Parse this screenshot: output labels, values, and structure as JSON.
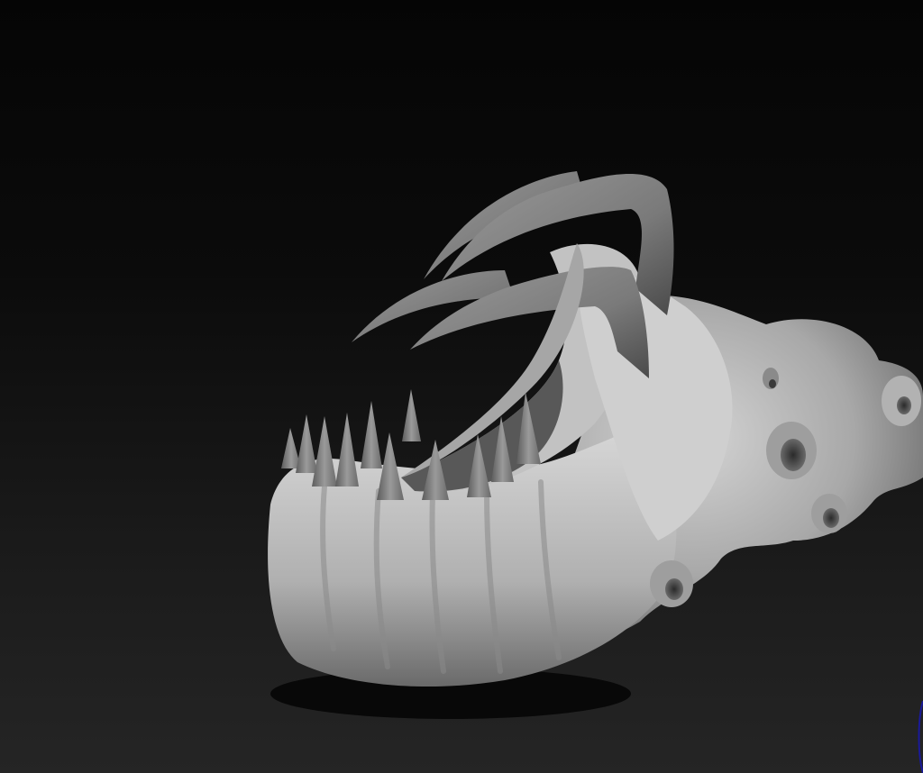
{
  "viewport": {
    "model": {
      "description_icon": "sculpted-creature-skull-model",
      "material_color": "#b8b8b8",
      "shadow_color": "#3a3a3a",
      "tooth_color": "#8d8d8d"
    },
    "background": {
      "top_color": "#050505",
      "bottom_color": "#252525"
    },
    "gizmo": {
      "icon": "orientation-gizmo-icon",
      "color": "#1a1a9a"
    }
  }
}
